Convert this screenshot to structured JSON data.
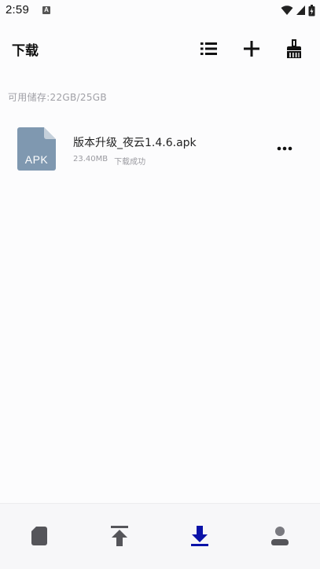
{
  "status_bar": {
    "time": "2:59",
    "notification_glyph": "A",
    "icons": [
      "wifi-icon",
      "signal-icon",
      "battery-icon"
    ]
  },
  "header": {
    "title": "下载",
    "actions": [
      "list-icon",
      "plus-icon",
      "broom-icon"
    ]
  },
  "storage": {
    "text": "可用储存:22GB/25GB"
  },
  "files": [
    {
      "icon_label": "APK",
      "name": "版本升级_夜云1.4.6.apk",
      "size": "23.40MB",
      "status": "下载成功"
    }
  ],
  "bottom_nav": {
    "items": [
      "file-icon",
      "upload-icon",
      "download-icon",
      "profile-icon"
    ],
    "active": "download-icon"
  },
  "colors": {
    "accent": "#0a12a8",
    "icon_inactive": "#55555a",
    "file_icon": "#7f98b0",
    "secondary_text": "#a0a0a6"
  }
}
